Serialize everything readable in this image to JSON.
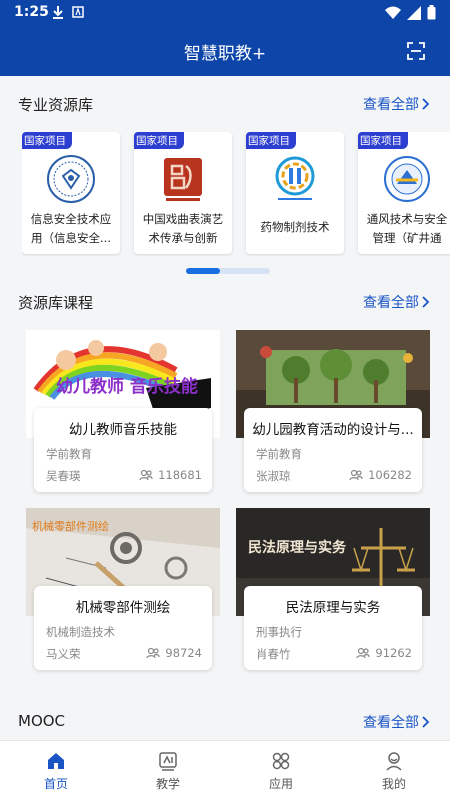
{
  "status_bar": {
    "time": "1:25"
  },
  "app_bar": {
    "title": "智慧职教+"
  },
  "resources": {
    "title": "专业资源库",
    "more": "查看全部",
    "items": [
      {
        "badge": "国家项目",
        "name": "信息安全技术应用（信息安全..."
      },
      {
        "badge": "国家项目",
        "name": "中国戏曲表演艺术传承与创新"
      },
      {
        "badge": "国家项目",
        "name": "药物制剂技术"
      },
      {
        "badge": "国家项目",
        "name": "通风技术与安全管理（矿井通"
      }
    ]
  },
  "courses": {
    "title": "资源库课程",
    "more": "查看全部",
    "items": [
      {
        "title": "幼儿教师音乐技能",
        "category": "学前教育",
        "teacher": "吴春瑛",
        "views": "118681",
        "thumb_text": "幼儿教师 音乐技能"
      },
      {
        "title": "幼儿园教育活动的设计与...",
        "category": "学前教育",
        "teacher": "张淑琼",
        "views": "106282"
      },
      {
        "title": "机械零部件测绘",
        "category": "机械制造技术",
        "teacher": "马义荣",
        "views": "98724",
        "thumb_text": "机械零部件测绘"
      },
      {
        "title": "民法原理与实务",
        "category": "刑事执行",
        "teacher": "肖春竹",
        "views": "91262",
        "thumb_text": "民法原理与实务"
      }
    ]
  },
  "mooc": {
    "title": "MOOC",
    "more": "查看全部"
  },
  "tabs": [
    {
      "label": "首页",
      "icon": "home-icon",
      "active": true
    },
    {
      "label": "教学",
      "icon": "teaching-icon",
      "active": false
    },
    {
      "label": "应用",
      "icon": "apps-icon",
      "active": false
    },
    {
      "label": "我的",
      "icon": "profile-icon",
      "active": false
    }
  ],
  "colors": {
    "primary": "#0d45a8",
    "link": "#1a55c6",
    "badge": "#2d3fd0"
  }
}
